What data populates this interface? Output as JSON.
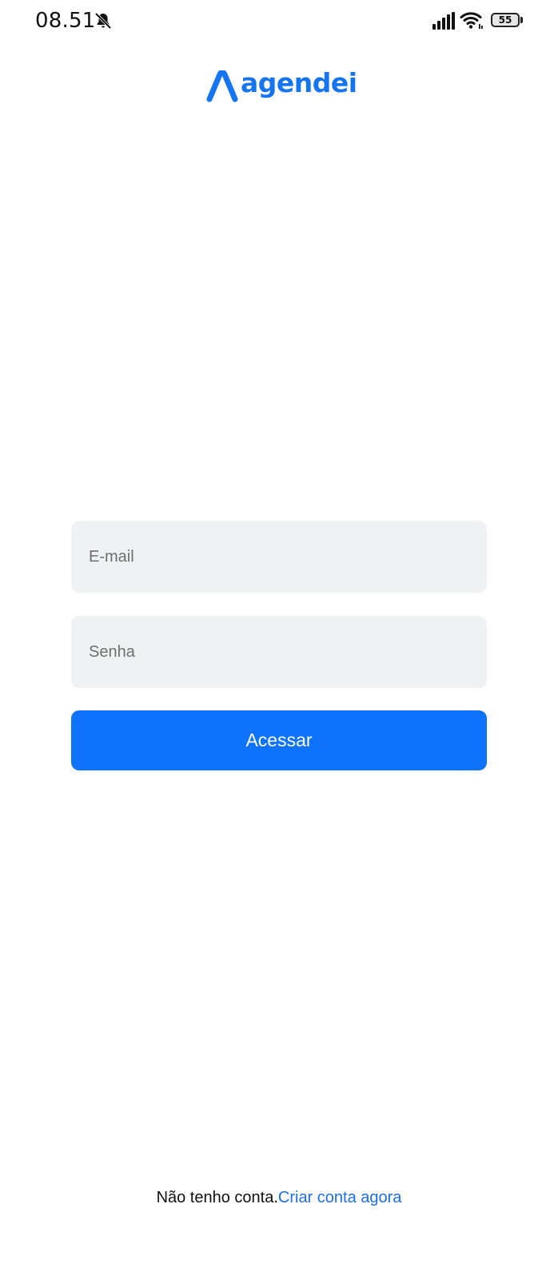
{
  "status_bar": {
    "time": "08.51",
    "battery_level": "55",
    "icons": [
      "bell-off-icon",
      "signal-icon",
      "wifi-icon",
      "battery-icon"
    ]
  },
  "brand": {
    "name": "agendei",
    "color": "#1574f0"
  },
  "login_form": {
    "email_placeholder": "E-mail",
    "email_value": "",
    "password_placeholder": "Senha",
    "password_value": "",
    "submit_label": "Acessar",
    "accent_color": "#0e72fb"
  },
  "footer": {
    "prompt": "Não tenho conta.",
    "link": "Criar conta agora"
  }
}
